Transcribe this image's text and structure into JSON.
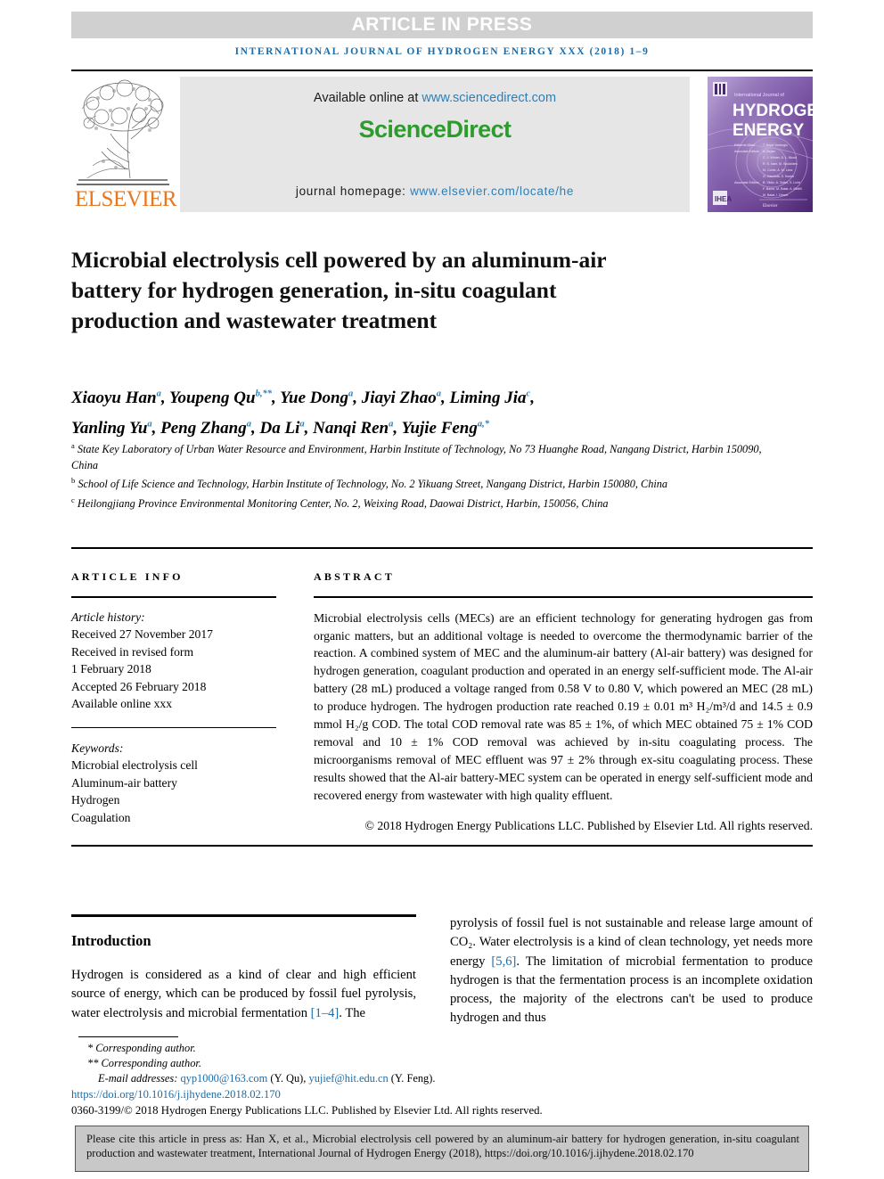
{
  "banner": {
    "text": "ARTICLE IN PRESS",
    "background": "#d0d0d0",
    "color": "#ffffff"
  },
  "running_head": {
    "text": "INTERNATIONAL JOURNAL OF HYDROGEN ENERGY XXX (2018) 1–9",
    "color": "#1b6ca8"
  },
  "masthead": {
    "publisher": "ELSEVIER",
    "publisher_color": "#e87722",
    "available_prefix": "Available online at ",
    "available_url": "www.sciencedirect.com",
    "brand_part1": "Science",
    "brand_part2": "Direct",
    "brand_color": "#2d9c2d",
    "homepage_label": "journal homepage: ",
    "homepage_url": "www.elsevier.com/locate/he",
    "link_color": "#2f7fb5",
    "cover": {
      "line1": "International Journal of",
      "line2": "HYDROGEN",
      "line3": "ENERGY",
      "publisher_mark": "Elsevier"
    }
  },
  "title": "Microbial electrolysis cell powered by an aluminum-air battery for hydrogen generation, in-situ coagulant production and wastewater treatment",
  "authors": {
    "line1": [
      {
        "name": "Xiaoyu Han",
        "sup": "a",
        "sep": ", "
      },
      {
        "name": "Youpeng Qu",
        "sup": "b,**",
        "sep": ", "
      },
      {
        "name": "Yue Dong",
        "sup": "a",
        "sep": ", "
      },
      {
        "name": "Jiayi Zhao",
        "sup": "a",
        "sep": ", "
      },
      {
        "name": "Liming Jia",
        "sup": "c",
        "sep": ","
      }
    ],
    "line2": [
      {
        "name": "Yanling Yu",
        "sup": "a",
        "sep": ", "
      },
      {
        "name": "Peng Zhang",
        "sup": "a",
        "sep": ", "
      },
      {
        "name": "Da Li",
        "sup": "a",
        "sep": ", "
      },
      {
        "name": "Nanqi Ren",
        "sup": "a",
        "sep": ", "
      },
      {
        "name": "Yujie Feng",
        "sup": "a,*",
        "sep": ""
      }
    ]
  },
  "affiliations": [
    {
      "mark": "a",
      "text": "State Key Laboratory of Urban Water Resource and Environment, Harbin Institute of Technology, No 73 Huanghe Road, Nangang District, Harbin 150090, China"
    },
    {
      "mark": "b",
      "text": "School of Life Science and Technology, Harbin Institute of Technology, No. 2 Yikuang Street, Nangang District, Harbin 150080, China"
    },
    {
      "mark": "c",
      "text": "Heilongjiang Province Environmental Monitoring Center, No. 2, Weixing Road, Daowai District, Harbin, 150056, China"
    }
  ],
  "article_info": {
    "heading": "ARTICLE INFO",
    "history_label": "Article history:",
    "history": [
      "Received 27 November 2017",
      "Received in revised form",
      "1 February 2018",
      "Accepted 26 February 2018",
      "Available online xxx"
    ],
    "keywords_label": "Keywords:",
    "keywords": [
      "Microbial electrolysis cell",
      "Aluminum-air battery",
      "Hydrogen",
      "Coagulation"
    ]
  },
  "abstract": {
    "heading": "ABSTRACT",
    "body": "Microbial electrolysis cells (MECs) are an efficient technology for generating hydrogen gas from organic matters, but an additional voltage is needed to overcome the thermodynamic barrier of the reaction. A combined system of MEC and the aluminum-air battery (Al-air battery) was designed for hydrogen generation, coagulant production and operated in an energy self-sufficient mode. The Al-air battery (28 mL) produced a voltage ranged from 0.58 V to 0.80 V, which powered an MEC (28 mL) to produce hydrogen. The hydrogen production rate reached 0.19 ± 0.01 m³ H₂/m³/d and 14.5 ± 0.9 mmol H₂/g COD. The total COD removal rate was 85 ± 1%, of which MEC obtained 75 ± 1% COD removal and 10 ± 1% COD removal was achieved by in-situ coagulating process. The microorganisms removal of MEC effluent was 97 ± 2% through ex-situ coagulating process. These results showed that the Al-air battery-MEC system can be operated in energy self-sufficient mode and recovered energy from wastewater with high quality effluent.",
    "copyright": "© 2018 Hydrogen Energy Publications LLC. Published by Elsevier Ltd. All rights reserved."
  },
  "introduction": {
    "heading": "Introduction",
    "left_text_a": "Hydrogen is considered as a kind of clear and high efficient source of energy, which can be produced by fossil fuel pyrolysis, water electrolysis and microbial fermentation ",
    "left_ref": "[1–4]",
    "left_text_b": ". The",
    "right_text_a": "pyrolysis of fossil fuel is not sustainable and release large amount of CO₂. Water electrolysis is a kind of clean technology, yet needs more energy ",
    "right_ref": "[5,6]",
    "right_text_b": ". The limitation of microbial fermentation to produce hydrogen is that the fermentation process is an incomplete oxidation process, the majority of the electrons can't be used to produce hydrogen and thus"
  },
  "footnotes": {
    "star": "* Corresponding author.",
    "doublestar": "** Corresponding author.",
    "email_label": "E-mail addresses: ",
    "email1": "qyp1000@163.com",
    "email1_owner": " (Y. Qu), ",
    "email2": "yujief@hit.edu.cn",
    "email2_owner": " (Y. Feng).",
    "doi": "https://doi.org/10.1016/j.ijhydene.2018.02.170",
    "issn": "0360-3199/© 2018 Hydrogen Energy Publications LLC. Published by Elsevier Ltd. All rights reserved."
  },
  "cite_box": {
    "text": "Please cite this article in press as: Han X, et al., Microbial electrolysis cell powered by an aluminum-air battery for hydrogen generation, in-situ coagulant production and wastewater treatment, International Journal of Hydrogen Energy (2018), https://doi.org/10.1016/j.ijhydene.2018.02.170",
    "background": "#c8c8c8"
  }
}
